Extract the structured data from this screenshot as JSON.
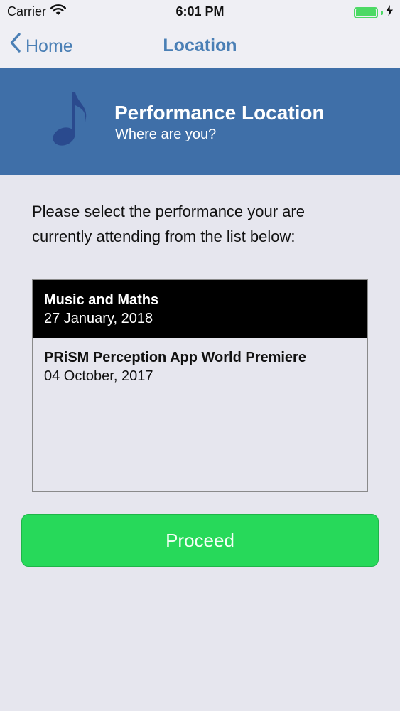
{
  "status_bar": {
    "carrier": "Carrier",
    "time": "6:01 PM",
    "icons": [
      "wifi-icon",
      "battery-icon",
      "charging-bolt-icon"
    ]
  },
  "nav": {
    "back_label": "Home",
    "title": "Location"
  },
  "header": {
    "icon": "music-note-icon",
    "title": "Performance Location",
    "subtitle": "Where are you?"
  },
  "instructions": "Please select the performance your are currently attending from the list below:",
  "performances": [
    {
      "title": "Music and Maths",
      "date": "27 January, 2018",
      "selected": true
    },
    {
      "title": "PRiSM Perception App World Premiere",
      "date": "04 October, 2017",
      "selected": false
    }
  ],
  "proceed_label": "Proceed",
  "colors": {
    "accent": "#4a7fb5",
    "banner": "#3f6fa8",
    "proceed": "#27d95a",
    "selected_row": "#000000"
  }
}
